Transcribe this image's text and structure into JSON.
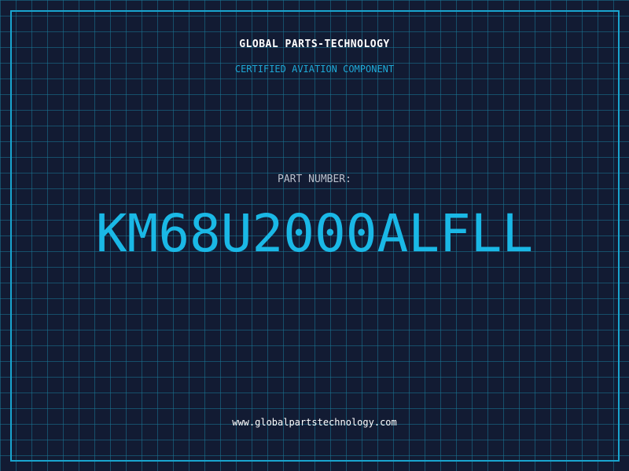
{
  "header": {
    "company_name": "GLOBAL PARTS-TECHNOLOGY",
    "subtitle": "CERTIFIED AVIATION COMPONENT"
  },
  "part": {
    "label": "PART NUMBER:",
    "number": "KM68U2000ALFLL"
  },
  "footer": {
    "website": "www.globalpartstechnology.com"
  },
  "colors": {
    "background": "#121b33",
    "grid": "#1a7896",
    "accent": "#19a5cf",
    "part_number": "#1ab8e6",
    "label": "#b9c0cc",
    "text": "#ffffff"
  }
}
